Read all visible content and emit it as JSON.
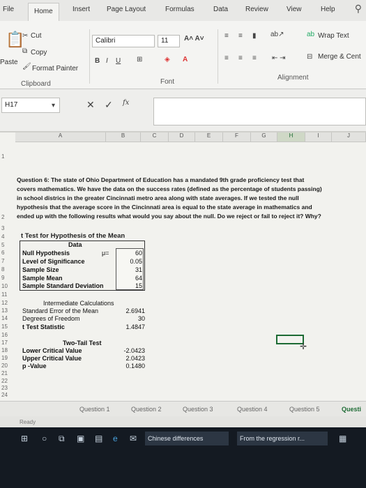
{
  "tabs": [
    "File",
    "Home",
    "Insert",
    "Page Layout",
    "Formulas",
    "Data",
    "Review",
    "View",
    "Help"
  ],
  "ribbon": {
    "cut": "Cut",
    "copy": "Copy",
    "paste": "Paste",
    "format_painter": "Format Painter",
    "clipboard": "Clipboard",
    "font_name": "Calibri",
    "font_size": "11",
    "font_group": "Font",
    "wrap_text": "Wrap Text",
    "merge_center": "Merge & Cent",
    "alignment_group": "Alignment"
  },
  "formula_bar": {
    "name_box": "H17",
    "fx": "fx"
  },
  "columns": [
    "A",
    "B",
    "C",
    "D",
    "E",
    "F",
    "G",
    "H",
    "I",
    "J"
  ],
  "selected_column": "H",
  "rows": [
    "1",
    "2",
    "3",
    "4",
    "5",
    "6",
    "7",
    "8",
    "9",
    "10",
    "11",
    "12",
    "13",
    "14",
    "15",
    "16",
    "17",
    "18",
    "19",
    "20",
    "21",
    "22",
    "23",
    "24"
  ],
  "question": "Question 6: The state of Ohio Department of Education has a mandated 9th grade proficiency test that covers mathematics. We have the data on the success rates (defined as the percentage of students passing) in school districs in the greater Cincinnati metro area along with state averages. If we tested the null hypothesis that the average score in the Cincinnati area is equal to the state average in mathematics and ended up with the following results what would you say about the null. Do we reject or fail to reject it? Why?",
  "ttest": {
    "title": "t Test for Hypothesis of the Mean",
    "data_header": "Data",
    "null_hypothesis": "Null Hypothesis",
    "mu": "μ=",
    "null_value": "60",
    "significance": "Level of Significance",
    "significance_value": "0.05",
    "sample_size": "Sample Size",
    "sample_size_value": "31",
    "sample_mean": "Sample Mean",
    "sample_mean_value": "64",
    "sample_sd": "Sample Standard Deviation",
    "sample_sd_value": "15",
    "intermediate": "Intermediate Calculations",
    "std_error": "Standard Error of the Mean",
    "std_error_value": "2.6941",
    "dof": "Degrees of Freedom",
    "dof_value": "30",
    "t_stat": "t Test Statistic",
    "t_stat_value": "1.4847",
    "two_tail": "Two-Tail Test",
    "lower_cv": "Lower Critical Value",
    "lower_cv_value": "-2.0423",
    "upper_cv": "Upper Critical Value",
    "upper_cv_value": "2.0423",
    "p_value": "p -Value",
    "p_value_value": "0.1480"
  },
  "sheets": [
    "Question 1",
    "Question 2",
    "Question 3",
    "Question 4",
    "Question 5",
    "Questi"
  ],
  "active_sheet": "Questi",
  "status": "Ready",
  "taskbar": {
    "app1": "Chinese differences",
    "app2": "From the regression r..."
  }
}
